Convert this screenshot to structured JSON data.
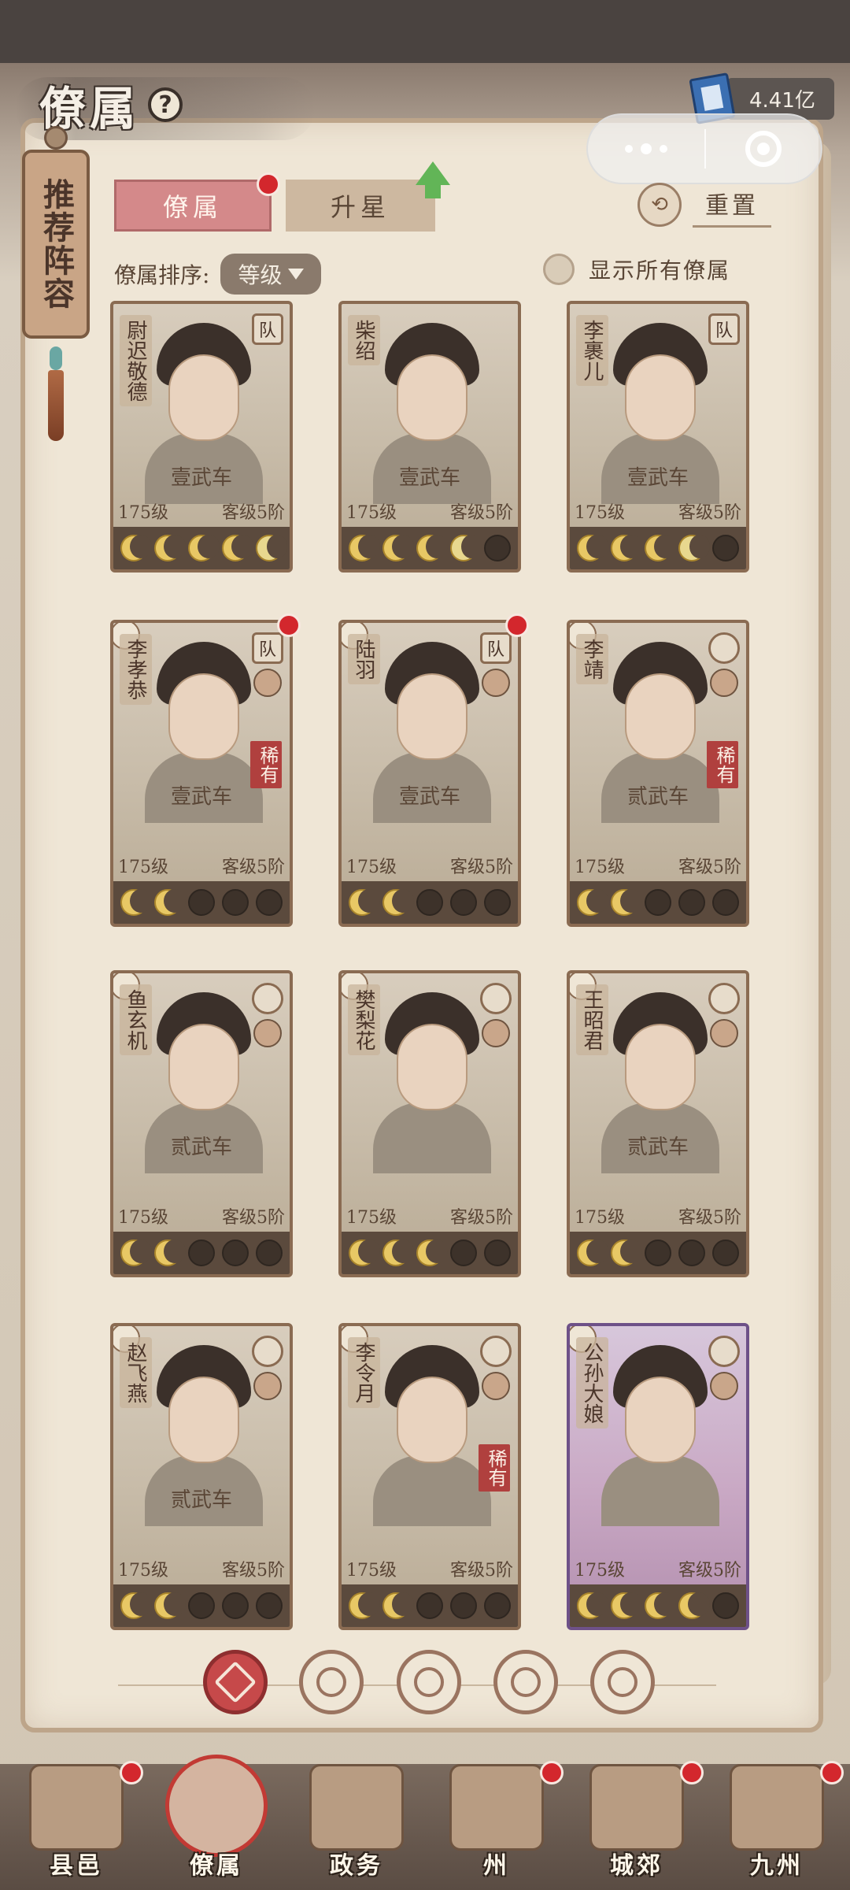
{
  "header": {
    "title": "僚属",
    "help_icon": "?",
    "currency_value": "4.41亿",
    "currency_icon": "book-icon"
  },
  "side_tag": {
    "label": "推荐阵容"
  },
  "tabs": [
    {
      "label": "僚属",
      "active": true,
      "has_dot": true
    },
    {
      "label": "升星",
      "active": false,
      "has_dot": false
    }
  ],
  "reset_label": "重置",
  "sort": {
    "label": "僚属排序:",
    "value": "等级"
  },
  "show_all_label": "显示所有僚属",
  "cards": [
    {
      "name": "尉迟敬德",
      "style": "壹武车",
      "level": "175级",
      "rank": "客级5阶",
      "badge": "队",
      "badge_type": "team",
      "rare": "",
      "moons": [
        "on",
        "on",
        "on",
        "on",
        "partial"
      ],
      "purple": false,
      "dot": false
    },
    {
      "name": "柴绍",
      "style": "壹武车",
      "level": "175级",
      "rank": "客级5阶",
      "badge": "",
      "badge_type": "none",
      "rare": "",
      "moons": [
        "on",
        "on",
        "on",
        "partial",
        "off"
      ],
      "purple": false,
      "dot": false
    },
    {
      "name": "李裹儿",
      "style": "壹武车",
      "level": "175级",
      "rank": "客级5阶",
      "badge": "队",
      "badge_type": "team",
      "rare": "",
      "moons": [
        "on",
        "on",
        "on",
        "partial",
        "off"
      ],
      "purple": false,
      "dot": false
    },
    {
      "name": "李孝恭",
      "style": "壹武车",
      "level": "175级",
      "rank": "客级5阶",
      "badge": "队",
      "badge_type": "team",
      "rare": "稀有",
      "moons": [
        "on",
        "on",
        "off",
        "off",
        "off"
      ],
      "purple": false,
      "dot": true
    },
    {
      "name": "陆羽",
      "style": "壹武车",
      "level": "175级",
      "rank": "客级5阶",
      "badge": "队",
      "badge_type": "team",
      "rare": "",
      "moons": [
        "on",
        "on",
        "off",
        "off",
        "off"
      ],
      "purple": false,
      "dot": true
    },
    {
      "name": "李靖",
      "style": "贰武车",
      "level": "175级",
      "rank": "客级5阶",
      "badge": "",
      "badge_type": "none",
      "rare": "稀有",
      "moons": [
        "on",
        "on",
        "off",
        "off",
        "off"
      ],
      "purple": false,
      "dot": false
    },
    {
      "name": "鱼玄机",
      "style": "贰武车",
      "level": "175级",
      "rank": "客级5阶",
      "badge": "",
      "badge_type": "none",
      "rare": "",
      "moons": [
        "on",
        "on",
        "off",
        "off",
        "off"
      ],
      "purple": false,
      "dot": false
    },
    {
      "name": "樊梨花",
      "style": "",
      "level": "175级",
      "rank": "客级5阶",
      "badge": "",
      "badge_type": "none",
      "rare": "",
      "moons": [
        "on",
        "on",
        "on",
        "off",
        "off"
      ],
      "purple": false,
      "dot": false
    },
    {
      "name": "王昭君",
      "style": "贰武车",
      "level": "175级",
      "rank": "客级5阶",
      "badge": "",
      "badge_type": "none",
      "rare": "",
      "moons": [
        "on",
        "on",
        "off",
        "off",
        "off"
      ],
      "purple": false,
      "dot": false
    },
    {
      "name": "赵飞燕",
      "style": "贰武车",
      "level": "175级",
      "rank": "客级5阶",
      "badge": "",
      "badge_type": "none",
      "rare": "",
      "moons": [
        "on",
        "on",
        "off",
        "off",
        "off"
      ],
      "purple": false,
      "dot": false
    },
    {
      "name": "李令月",
      "style": "",
      "level": "175级",
      "rank": "客级5阶",
      "badge": "",
      "badge_type": "none",
      "rare": "稀有",
      "moons": [
        "on",
        "on",
        "off",
        "off",
        "off"
      ],
      "purple": false,
      "dot": false
    },
    {
      "name": "公孙大娘",
      "style": "",
      "level": "175级",
      "rank": "客级5阶",
      "badge": "",
      "badge_type": "none",
      "rare": "",
      "moons": [
        "on",
        "on",
        "on",
        "on",
        "off"
      ],
      "purple": true,
      "dot": false
    }
  ],
  "filters": [
    {
      "name": "all-filter-icon",
      "active": true
    },
    {
      "name": "helmet-filter-icon",
      "active": false
    },
    {
      "name": "gourd-filter-icon",
      "active": false
    },
    {
      "name": "fan-filter-icon",
      "active": false
    },
    {
      "name": "beast-filter-icon",
      "active": false
    }
  ],
  "bottom_nav": [
    {
      "label": "县邑",
      "active": false,
      "dot": true
    },
    {
      "label": "僚属",
      "active": true,
      "dot": false
    },
    {
      "label": "政务",
      "active": false,
      "dot": false
    },
    {
      "label": "州",
      "active": false,
      "dot": true
    },
    {
      "label": "城郊",
      "active": false,
      "dot": true
    },
    {
      "label": "九州",
      "active": false,
      "dot": true
    }
  ]
}
